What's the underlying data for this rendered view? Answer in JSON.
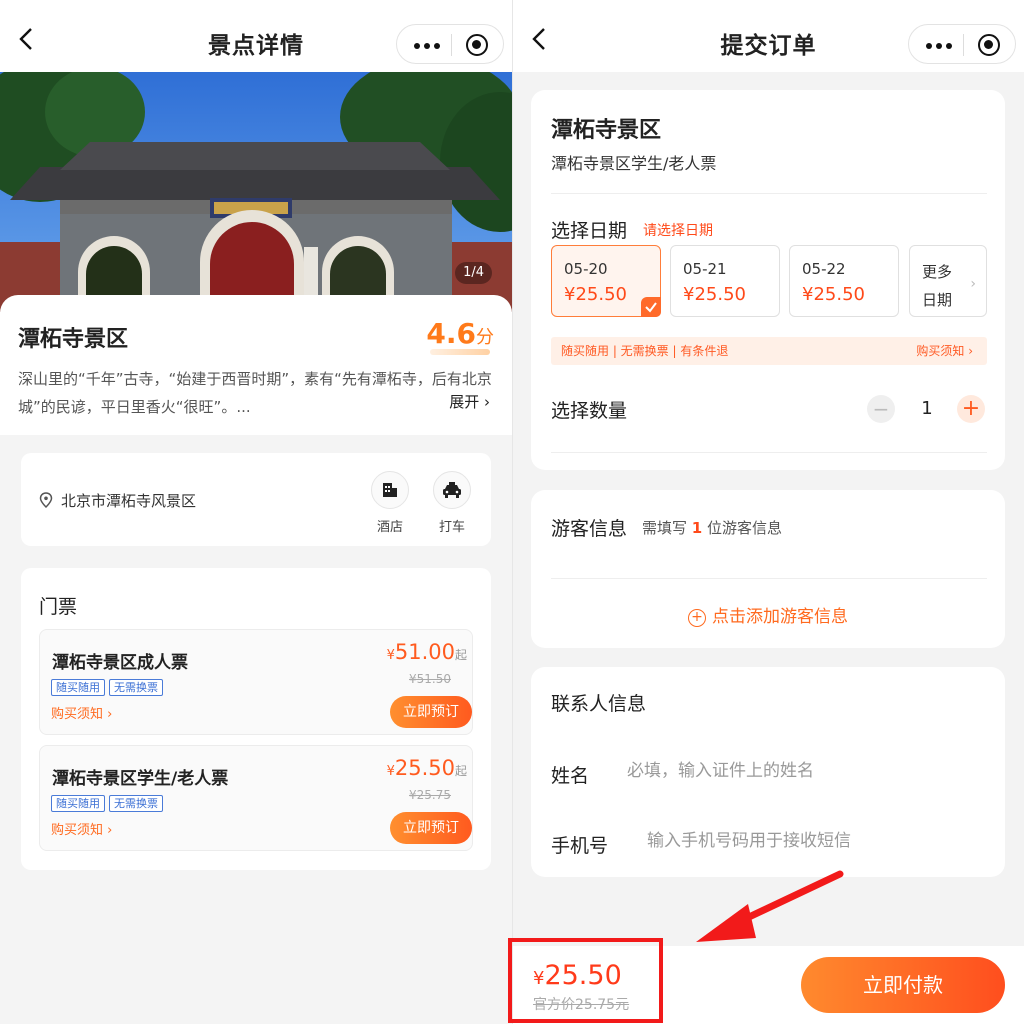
{
  "left": {
    "nav_title": "景点详情",
    "image_counter": "1/4",
    "scenic": {
      "name": "潭柘寺景区",
      "score": "4.6",
      "score_unit": "分",
      "description": "深山里的“千年”古寺，“始建于西晋时期”，素有“先有潭柘寺，后有北京城”的民谚，平日里香火“很旺”。...",
      "expand": "展开 ›"
    },
    "location": {
      "address": "北京市潭柘寺风景区",
      "hotel": "酒店",
      "taxi": "打车"
    },
    "tickets": {
      "title": "门票",
      "items": [
        {
          "name": "潭柘寺景区成人票",
          "currency": "¥",
          "price": "51.00",
          "qi": "起",
          "original": "¥51.50",
          "tag1": "随买随用",
          "tag2": "无需换票",
          "notice": "购买须知 ›",
          "book": "立即预订"
        },
        {
          "name": "潭柘寺景区学生/老人票",
          "currency": "¥",
          "price": "25.50",
          "qi": "起",
          "original": "¥25.75",
          "tag1": "随买随用",
          "tag2": "无需换票",
          "notice": "购买须知 ›",
          "book": "立即预订"
        }
      ]
    }
  },
  "right": {
    "nav_title": "提交订单",
    "order": {
      "scenic_name": "潭柘寺景区",
      "ticket_name": "潭柘寺景区学生/老人票",
      "date_title": "选择日期",
      "date_hint": "请选择日期",
      "dates": [
        {
          "date": "05-20",
          "price": "¥25.50",
          "selected": true
        },
        {
          "date": "05-21",
          "price": "¥25.50",
          "selected": false
        },
        {
          "date": "05-22",
          "price": "¥25.50",
          "selected": false
        }
      ],
      "more_dates": "更多日期",
      "policy_left": "随买随用 | 无需换票 | 有条件退",
      "policy_right": "购买须知 ›",
      "qty_label": "选择数量",
      "qty": "1"
    },
    "guest": {
      "title": "游客信息",
      "need_prefix": "需填写",
      "need_count": "1",
      "need_suffix": "位游客信息",
      "add": "点击添加游客信息"
    },
    "contact": {
      "title": "联系人信息",
      "name_label": "姓名",
      "name_placeholder": "必填，输入证件上的姓名",
      "phone_label": "手机号",
      "phone_placeholder": "输入手机号码用于接收短信"
    },
    "footer": {
      "currency": "¥",
      "total": "25.50",
      "official": "官方价25.75元",
      "pay": "立即付款"
    }
  },
  "colors": {
    "accent": "#ff5a1f",
    "highlight_annotation": "#f21a1a",
    "tag_blue": "#3b6fd4"
  }
}
